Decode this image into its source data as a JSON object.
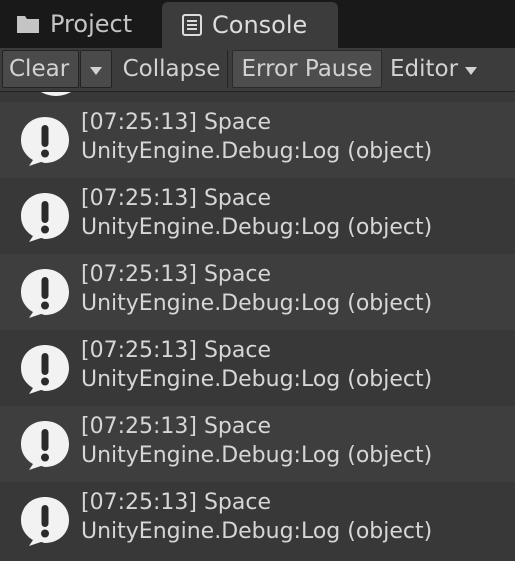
{
  "tabs": [
    {
      "label": "Project",
      "icon": "folder-icon",
      "active": false
    },
    {
      "label": "Console",
      "icon": "console-icon",
      "active": true
    }
  ],
  "toolbar": {
    "clear_label": "Clear",
    "collapse_label": "Collapse",
    "error_pause_label": "Error Pause",
    "editor_label": "Editor"
  },
  "logs": [
    {
      "time": "[07:25:13] Space",
      "detail": "UnityEngine.Debug:Log (object)"
    },
    {
      "time": "[07:25:13] Space",
      "detail": "UnityEngine.Debug:Log (object)"
    },
    {
      "time": "[07:25:13] Space",
      "detail": "UnityEngine.Debug:Log (object)"
    },
    {
      "time": "[07:25:13] Space",
      "detail": "UnityEngine.Debug:Log (object)"
    },
    {
      "time": "[07:25:13] Space",
      "detail": "UnityEngine.Debug:Log (object)"
    },
    {
      "time": "[07:25:13] Space",
      "detail": "UnityEngine.Debug:Log (object)"
    }
  ],
  "colors": {
    "background": "#383838",
    "tabbar": "#191919",
    "row_alt": "#3e3e3e",
    "text": "#d6d6d6",
    "icon": "#f2f2f2"
  }
}
